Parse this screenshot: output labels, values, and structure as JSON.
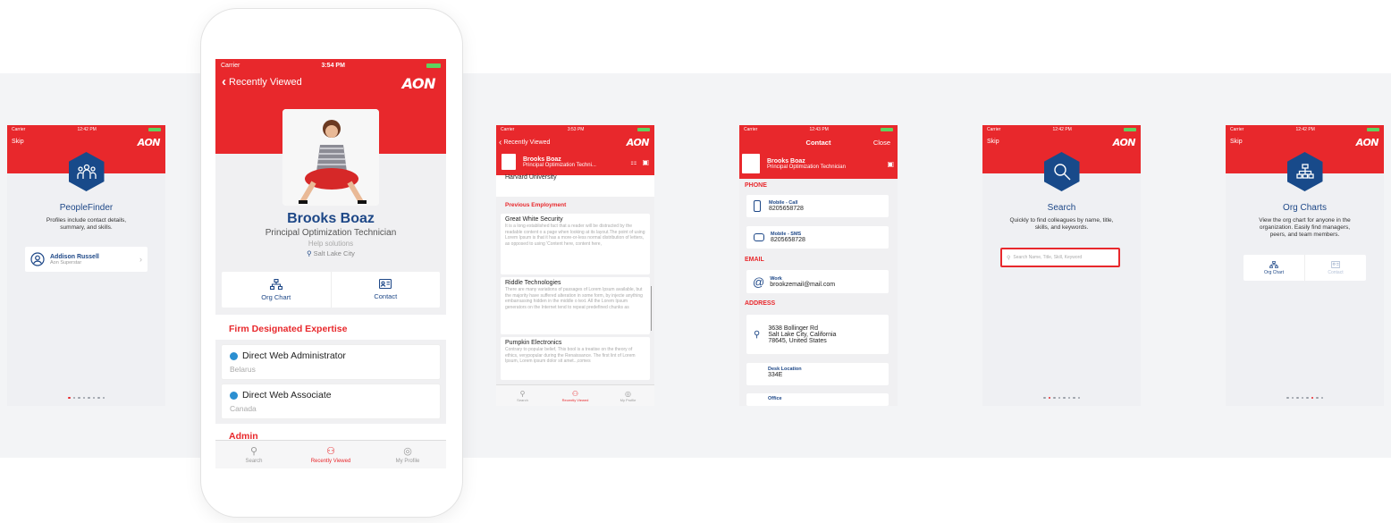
{
  "onboarding1": {
    "carrier": "Carrier",
    "time": "12:42 PM",
    "skip": "Skip",
    "logo": "AON",
    "icon": "people-group-icon",
    "title": "PeopleFinder",
    "desc1": "Profiles include contact details,",
    "desc2": "summary, and skills.",
    "person_name": "Addison Russell",
    "person_role": "Aon Superstar"
  },
  "profile": {
    "carrier": "Carrier",
    "time": "3:54 PM",
    "back": "Recently Viewed",
    "logo": "AON",
    "name": "Brooks Boaz",
    "title": "Principal Optimization Technician",
    "dept": "Help solutions",
    "location": "Salt Lake City",
    "action_org": "Org Chart",
    "action_contact": "Contact",
    "expertise_header": "Firm Designated Expertise",
    "expertise": [
      {
        "name": "Direct Web Administrator",
        "place": "Belarus"
      },
      {
        "name": "Direct Web Associate",
        "place": "Canada"
      }
    ],
    "admin_header": "Admin",
    "tabs": [
      "Search",
      "Recently Viewed",
      "My Profile"
    ]
  },
  "employment": {
    "carrier": "Carrier",
    "time": "3:53 PM",
    "back": "Recently Viewed",
    "logo": "AON",
    "name": "Brooks Boaz",
    "title": "Principal Optimization Techni...",
    "school": "Harvard University",
    "section": "Previous Employment",
    "jobs": [
      {
        "company": "Great White Security",
        "text": "It is a long established fact that a reader will be distracted by the readable content o a page when looking at its layout.The point of using Lorem Ipsum is that it has a more-or-less normal distribution of letters, as opposed to using 'Content here, content here,"
      },
      {
        "company": "Riddle Technologies",
        "text": "There are many variations of passages of Lorem Ipsum available, but the majority have suffered alteration in some form, by injecte anything embarrassing hidden in the middle o text. All the Lorem Ipsum generators on the Internet tend to repeat predefined chunks as"
      },
      {
        "company": "Pumpkin Electronics",
        "text": "Contrary to popular belief, This bool is a treatise on the theory of ethics, verypopular during the Renaissance. The first lint of Lorem Ipsum, Lorem ipsum dolor sit amet..,comes"
      }
    ],
    "tabs": [
      "Search",
      "Recently Viewed",
      "My Profile"
    ]
  },
  "contact": {
    "carrier": "Carrier",
    "time": "12:43 PM",
    "header": "Contact",
    "close": "Close",
    "name": "Brooks Boaz",
    "title": "Principal Optimization Technician",
    "phone_header": "PHONE",
    "mobile_call_label": "Mobile - Call",
    "mobile_call": "8205658728",
    "mobile_sms_label": "Mobile - SMS",
    "mobile_sms": "8205658728",
    "email_header": "EMAIL",
    "work_label": "Work",
    "work_email": "brookzemail@mail.com",
    "address_header": "ADDRESS",
    "address1": "3638 Bollinger Rd",
    "address2": "Salt Lake City, California",
    "address3": "78645, United States",
    "desk_label": "Desk Location",
    "desk": "334E",
    "office_label": "Office"
  },
  "onboarding_search": {
    "carrier": "Carrier",
    "time": "12:42 PM",
    "skip": "Skip",
    "logo": "AON",
    "icon": "magnifier-icon",
    "title": "Search",
    "desc1": "Quickly to find colleagues by name, title,",
    "desc2": "skills, and keywords.",
    "placeholder": "Search Name, Title, Skill, Keyword"
  },
  "onboarding_org": {
    "carrier": "Carrier",
    "time": "12:42 PM",
    "skip": "Skip",
    "logo": "AON",
    "icon": "org-chart-icon",
    "title": "Org Charts",
    "desc1": "View the org chart for anyone in the",
    "desc2": "organization. Easily find managers,",
    "desc3": "peers, and team members.",
    "action_org": "Org Chart",
    "action_contact": "Contact"
  },
  "colors": {
    "brand_red": "#e8282c",
    "navy": "#1d4787",
    "hex_blue": "#184a8a",
    "battery_green": "#5fd35f"
  }
}
